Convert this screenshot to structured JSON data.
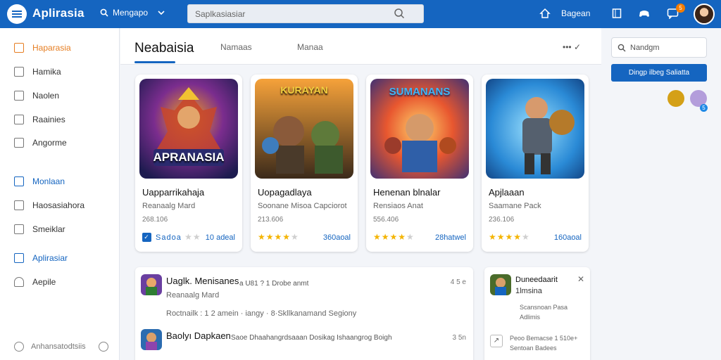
{
  "topbar": {
    "app_title": "Aplirasia",
    "nav_label": "Mengapo",
    "search_placeholder": "Saplkasiasiar",
    "right_label": "Bagean",
    "notification_count": "5"
  },
  "sidebar": {
    "items": [
      {
        "label": "Haparasia"
      },
      {
        "label": "Hamika"
      },
      {
        "label": "Naolen"
      },
      {
        "label": "Raainies"
      },
      {
        "label": "Angorme"
      },
      {
        "label": "Monlaan"
      },
      {
        "label": "Haosasiahora"
      },
      {
        "label": "Smeiklar"
      },
      {
        "label": "Aplirasiar"
      },
      {
        "label": "Aepile"
      }
    ],
    "footer_label": "Anhansatodtsiis"
  },
  "main": {
    "tabs": [
      {
        "label": "Neabaisia"
      },
      {
        "label": "Namaas"
      },
      {
        "label": "Manaa"
      }
    ],
    "head_more": "••• ✓"
  },
  "cards": [
    {
      "name": "Uapparrikahaja",
      "sub": "Reanaalg Mard",
      "size": "268.106",
      "rating": 2,
      "count": "10 adeal",
      "first_label": "Sadoa",
      "art_text": "APRANASIA"
    },
    {
      "name": "Uopagadlaya",
      "sub": "Soonane Misoa Capciorot",
      "size": "213.606",
      "rating": 4,
      "count": "360aoal",
      "first_label": "",
      "art_text": "KURAYAN"
    },
    {
      "name": "Henenan blnalar",
      "sub": "Rensiaos Anat",
      "size": "556.406",
      "rating": 4,
      "count": "28hatwel",
      "first_label": "",
      "art_text": "SUMANANS"
    },
    {
      "name": "Apjlaaan",
      "sub": "Saamane Pack",
      "size": "236.106",
      "rating": 4,
      "count": "160aoal",
      "first_label": "",
      "art_text": ""
    }
  ],
  "list": [
    {
      "title": "Uaglk. Menisanes",
      "meta": "a  U81 ?  1  Drobe anmt",
      "sub": "Roctnailk : 1 2 amein  ·  iangy  ·  8·Skllkanamand Segiony",
      "time": "4 5 e"
    },
    {
      "title": "Baolyı Dapkaen",
      "meta": "Saoe  Dhaahangrdsaaan Dosikag  Ishaangrog Boigh",
      "sub": "",
      "time": "3 5n"
    }
  ],
  "right": {
    "input_label": "Nandgm",
    "button_label": "Dingp ilbeg Saliatta",
    "circle_badge": "5"
  },
  "notification": {
    "title": "Duneedaarit",
    "subtitle": "1lmsina",
    "line1": "Scansnoan Pasa",
    "line2": "Adlimis",
    "line3": "Peoo Bemacse 1 510e+",
    "line4": "Sentoan Badees"
  }
}
